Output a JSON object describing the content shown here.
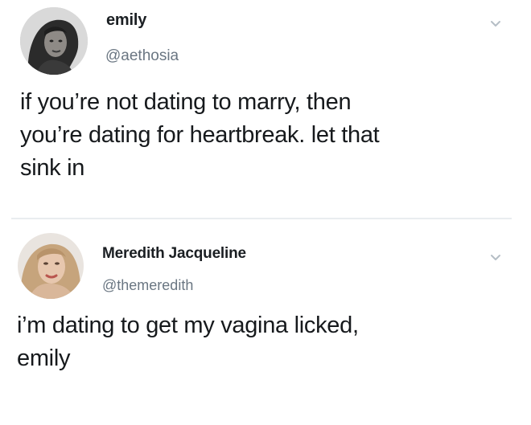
{
  "tweets": [
    {
      "name": "emily",
      "handle": "@aethosia",
      "text_lines": [
        "if you’re not dating to marry, then",
        "you’re dating for heartbreak. let that",
        "sink in"
      ]
    },
    {
      "name": "Meredith Jacqueline",
      "handle": "@themeredith",
      "text_lines": [
        "i’m dating to get my vagina licked,",
        "emily"
      ]
    }
  ],
  "icons": {
    "menu": "chevron-down-icon",
    "avatar": "avatar"
  },
  "colors": {
    "name": "#1b1f23",
    "handle": "#6a7682",
    "text": "#16191c",
    "chevron": "#b5bec6",
    "divider": "#e9edf0"
  }
}
